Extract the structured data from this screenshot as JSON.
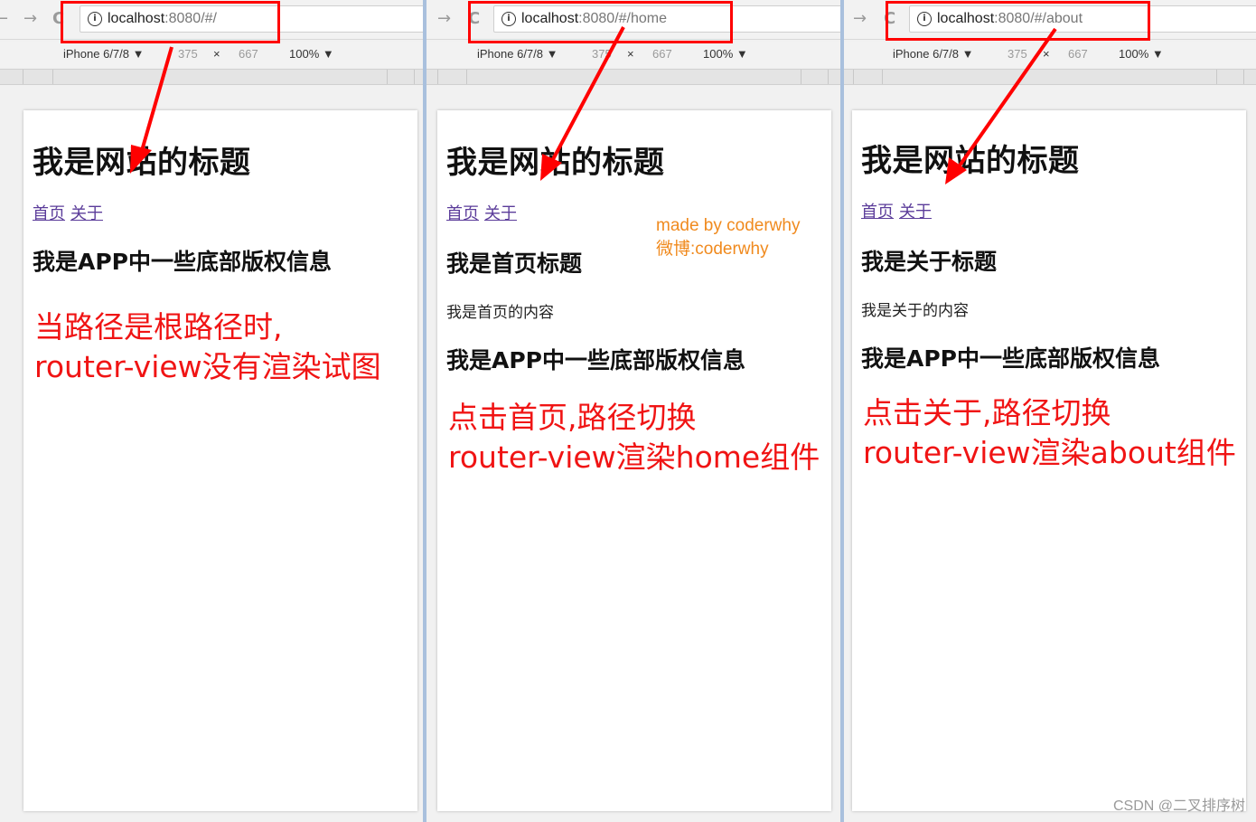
{
  "colors": {
    "annotation_red": "#f01414",
    "link_purple": "#5b3c9a",
    "watermark_orange": "#f08a1e",
    "separator_blue": "#a9c0dd"
  },
  "panels": [
    {
      "url_host": "localhost",
      "url_rest": ":8080/#/",
      "device": "iPhone 6/7/8 ▼",
      "width": "375",
      "times": "×",
      "height": "667",
      "zoom": "100% ▼",
      "site_title": "我是网站的标题",
      "link_home": "首页",
      "link_about": "关于",
      "content_title": "",
      "content_text": "",
      "footer_text": "我是APP中一些底部版权信息",
      "note_line1": "当路径是根路径时,",
      "note_line2": "router-view没有渲染试图"
    },
    {
      "url_host": "localhost",
      "url_rest": ":8080/#/home",
      "device": "iPhone 6/7/8 ▼",
      "width": "375",
      "times": "×",
      "height": "667",
      "zoom": "100% ▼",
      "site_title": "我是网站的标题",
      "link_home": "首页",
      "link_about": "关于",
      "content_title": "我是首页标题",
      "content_text": "我是首页的内容",
      "footer_text": "我是APP中一些底部版权信息",
      "note_line1": "点击首页,路径切换",
      "note_line2": "router-view渲染home组件",
      "watermark_line1": "made by coderwhy",
      "watermark_line2": "微博:coderwhy"
    },
    {
      "url_host": "localhost",
      "url_rest": ":8080/#/about",
      "device": "iPhone 6/7/8 ▼",
      "width": "375",
      "times": "×",
      "height": "667",
      "zoom": "100% ▼",
      "site_title": "我是网站的标题",
      "link_home": "首页",
      "link_about": "关于",
      "content_title": "我是关于标题",
      "content_text": "我是关于的内容",
      "footer_text": "我是APP中一些底部版权信息",
      "note_line1": "点击关于,路径切换",
      "note_line2": "router-view渲染about组件"
    }
  ],
  "icons": {
    "back": "←",
    "forward": "→",
    "reload": "C",
    "info": "i"
  },
  "credit": "CSDN @二叉排序树"
}
